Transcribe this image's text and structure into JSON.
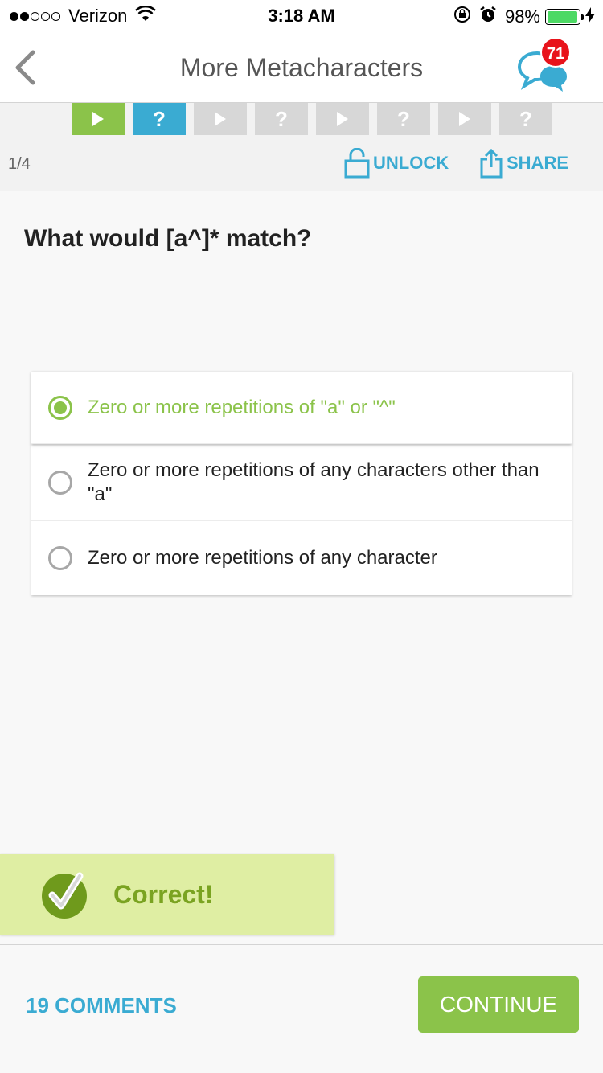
{
  "status_bar": {
    "carrier": "Verizon",
    "time": "3:18 AM",
    "battery": "98%",
    "battery_level": 0.98,
    "signal_filled": 2,
    "signal_total": 5
  },
  "nav": {
    "title": "More Metacharacters",
    "back_icon": "chevron-left-icon",
    "chat_icon": "chat-bubbles-icon",
    "badge": "71"
  },
  "progress": {
    "tiles": [
      {
        "kind": "play",
        "state": "done"
      },
      {
        "kind": "quiz",
        "state": "active",
        "label": "?"
      },
      {
        "kind": "play",
        "state": "locked"
      },
      {
        "kind": "quiz",
        "state": "locked",
        "label": "?"
      },
      {
        "kind": "play",
        "state": "locked"
      },
      {
        "kind": "quiz",
        "state": "locked",
        "label": "?"
      },
      {
        "kind": "play",
        "state": "locked"
      },
      {
        "kind": "quiz",
        "state": "locked",
        "label": "?"
      }
    ],
    "page_count": "1/4",
    "unlock_label": "UNLOCK",
    "share_label": "SHARE"
  },
  "question": {
    "text": "What would [a^]* match?"
  },
  "options": [
    {
      "text": "Zero or more repetitions of \"a\" or \"^\"",
      "selected": true
    },
    {
      "text": "Zero or more repetitions of any characters other than \"a\"",
      "selected": false
    },
    {
      "text": "Zero or more repetitions of any character",
      "selected": false
    }
  ],
  "feedback": {
    "text": "Correct!",
    "icon": "checkmark-icon"
  },
  "footer": {
    "comments_label": "19 COMMENTS",
    "continue_label": "CONTINUE"
  },
  "colors": {
    "accent_green": "#8bc34a",
    "accent_blue": "#3aabd2",
    "badge_red": "#e8131b",
    "correct_bg": "#dfeea3"
  }
}
